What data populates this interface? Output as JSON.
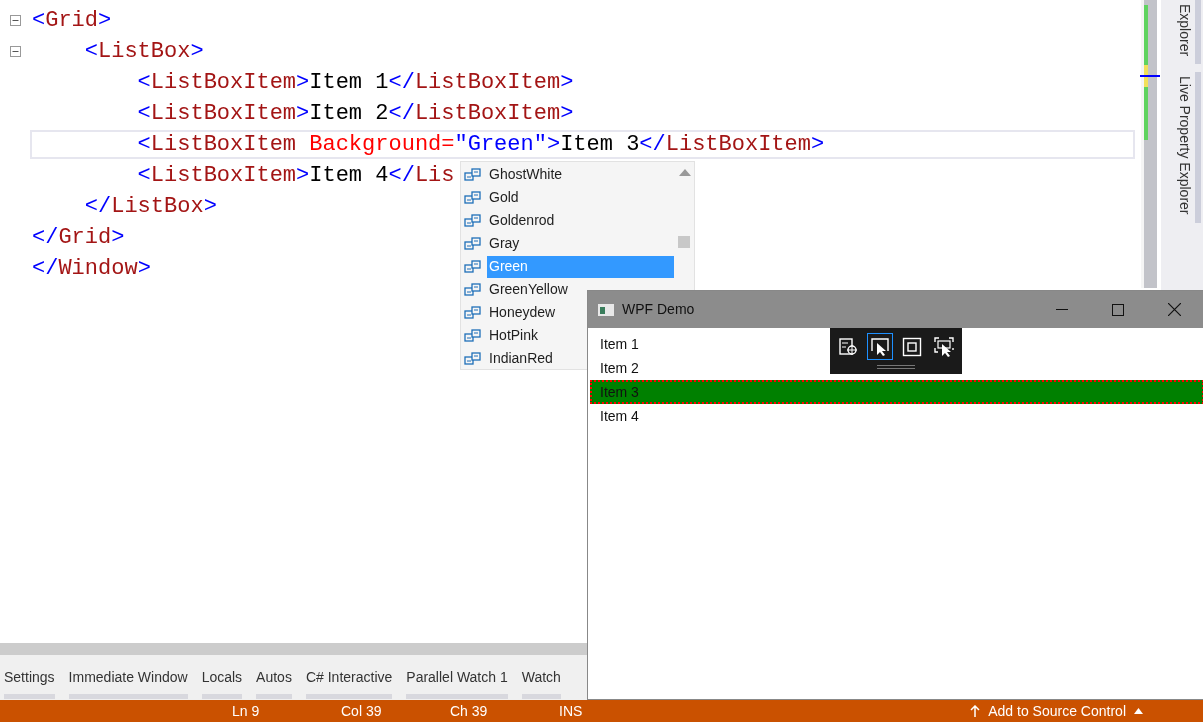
{
  "editor": {
    "lines": [
      {
        "expanded": true,
        "current": false,
        "tokens": [
          {
            "kind": "punct",
            "text": "<"
          },
          {
            "kind": "tag",
            "text": "Grid"
          },
          {
            "kind": "punct",
            "text": ">"
          }
        ]
      },
      {
        "expanded": true,
        "current": false,
        "tokens": [
          {
            "kind": "punct",
            "text": "    <"
          },
          {
            "kind": "tag",
            "text": "ListBox"
          },
          {
            "kind": "punct",
            "text": ">"
          }
        ]
      },
      {
        "current": false,
        "tokens": [
          {
            "kind": "punct",
            "text": "        <"
          },
          {
            "kind": "tag",
            "text": "ListBoxItem"
          },
          {
            "kind": "punct",
            "text": ">"
          },
          {
            "kind": "text",
            "text": "Item 1"
          },
          {
            "kind": "punct",
            "text": "</"
          },
          {
            "kind": "tag",
            "text": "ListBoxItem"
          },
          {
            "kind": "punct",
            "text": ">"
          }
        ]
      },
      {
        "current": false,
        "tokens": [
          {
            "kind": "punct",
            "text": "        <"
          },
          {
            "kind": "tag",
            "text": "ListBoxItem"
          },
          {
            "kind": "punct",
            "text": ">"
          },
          {
            "kind": "text",
            "text": "Item 2"
          },
          {
            "kind": "punct",
            "text": "</"
          },
          {
            "kind": "tag",
            "text": "ListBoxItem"
          },
          {
            "kind": "punct",
            "text": ">"
          }
        ]
      },
      {
        "current": true,
        "tokens": [
          {
            "kind": "punct",
            "text": "        <"
          },
          {
            "kind": "tag",
            "text": "ListBoxItem "
          },
          {
            "kind": "attr",
            "text": "Background="
          },
          {
            "kind": "value",
            "text": "\"Green\""
          },
          {
            "kind": "punct",
            "text": ">"
          },
          {
            "kind": "text",
            "text": "Item 3"
          },
          {
            "kind": "punct",
            "text": "</"
          },
          {
            "kind": "tag",
            "text": "ListBoxItem"
          },
          {
            "kind": "punct",
            "text": ">"
          }
        ]
      },
      {
        "current": false,
        "tokens": [
          {
            "kind": "punct",
            "text": "        <"
          },
          {
            "kind": "tag",
            "text": "ListBoxItem"
          },
          {
            "kind": "punct",
            "text": ">"
          },
          {
            "kind": "text",
            "text": "Item 4"
          },
          {
            "kind": "punct",
            "text": "</"
          },
          {
            "kind": "tag",
            "text": "Lis"
          }
        ]
      },
      {
        "current": false,
        "tokens": [
          {
            "kind": "punct",
            "text": "    </"
          },
          {
            "kind": "tag",
            "text": "ListBox"
          },
          {
            "kind": "punct",
            "text": ">"
          }
        ]
      },
      {
        "current": false,
        "tokens": [
          {
            "kind": "punct",
            "text": "</"
          },
          {
            "kind": "tag",
            "text": "Grid"
          },
          {
            "kind": "punct",
            "text": ">"
          }
        ]
      },
      {
        "current": false,
        "tokens": [
          {
            "kind": "punct",
            "text": "</"
          },
          {
            "kind": "tag",
            "text": "Window"
          },
          {
            "kind": "punct",
            "text": ">"
          }
        ]
      }
    ]
  },
  "completion": {
    "items": [
      {
        "label": "GhostWhite",
        "selected": false
      },
      {
        "label": "Gold",
        "selected": false
      },
      {
        "label": "Goldenrod",
        "selected": false
      },
      {
        "label": "Gray",
        "selected": false
      },
      {
        "label": "Green",
        "selected": true
      },
      {
        "label": "GreenYellow",
        "selected": false
      },
      {
        "label": "Honeydew",
        "selected": false
      },
      {
        "label": "HotPink",
        "selected": false
      },
      {
        "label": "IndianRed",
        "selected": false
      }
    ]
  },
  "side_tabs": [
    "Explorer",
    "Live Property Explorer"
  ],
  "bottom_tabs": [
    "Settings",
    "Immediate Window",
    "Locals",
    "Autos",
    "C# Interactive",
    "Parallel Watch 1",
    "Watch"
  ],
  "status_bar": {
    "items": [
      "Ln 9",
      "Col 39",
      "Ch 39",
      "INS"
    ],
    "source_control": "Add to Source Control"
  },
  "app_window": {
    "title": "WPF Demo",
    "tools": [
      {
        "selected": false
      },
      {
        "selected": true
      },
      {
        "selected": false
      },
      {
        "selected": false
      }
    ],
    "items": [
      {
        "label": "Item 1",
        "adorned": false
      },
      {
        "label": "Item 2",
        "adorned": false
      },
      {
        "label": "Item 3",
        "adorned": true,
        "color": "#008000"
      },
      {
        "label": "Item 4",
        "adorned": false
      }
    ]
  }
}
